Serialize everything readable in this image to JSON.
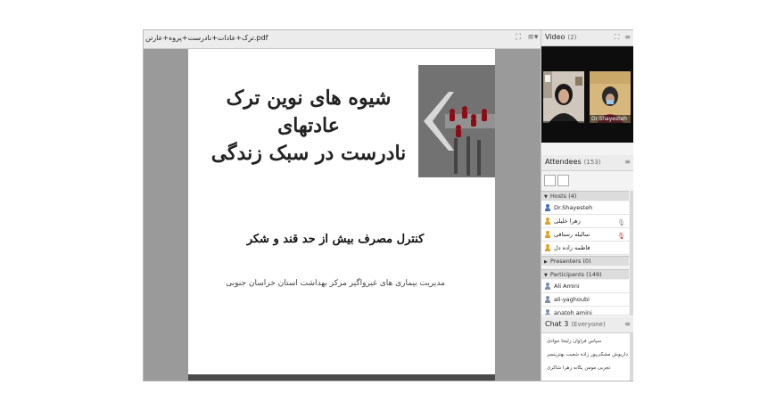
{
  "share_pod": {
    "title": "ترک+عادات+نادرست+پروه+عارتن.pdf",
    "icons": [
      "fullscreen-icon",
      "pod-menu-icon"
    ]
  },
  "slide": {
    "title_line1": "شیوه های نوین ترک عادتهای",
    "title_line2": "نادرست در سبک زندگی",
    "subtitle": "کنترل مصرف بیش از حد قند و شکر",
    "organization": "مدیریت بیماری های غیرواگیر مرکز بهداشت استان خراسان جنوبی",
    "image_icon": "arrow-pawns-image"
  },
  "video_pod": {
    "title": "Video",
    "count": "(2)",
    "participants": [
      {
        "name": ""
      },
      {
        "name": "Dr.Shayesteh"
      }
    ]
  },
  "attendees_pod": {
    "title": "Attendees",
    "count": "(153)",
    "hosts_header": "Hosts (4)",
    "hosts": [
      {
        "name": "Dr.Shayesteh",
        "color": "#3f6fc0"
      },
      {
        "name": "زهرا خلیلی",
        "color": "#e0a020"
      },
      {
        "name": "سالیله رستاقی",
        "color": "#e0a020"
      },
      {
        "name": "فاطمه زاده دل",
        "color": "#e0a020"
      }
    ],
    "presenters_header": "Presenters (0)",
    "participants_header": "Participants (149)",
    "participants": [
      {
        "name": "Ali Amini"
      },
      {
        "name": "ali-yaghoubi"
      },
      {
        "name": "anatoh amini"
      }
    ]
  },
  "chat_pod": {
    "title": "Chat 3",
    "scope": "(Everyone)",
    "messages": [
      "سپاس فراوان زلیخا جوادی",
      "داریوش مشکی‌پور زاده شعیب بهترینسر",
      "تجربی مومن یگانه زهرا شاکری"
    ]
  }
}
